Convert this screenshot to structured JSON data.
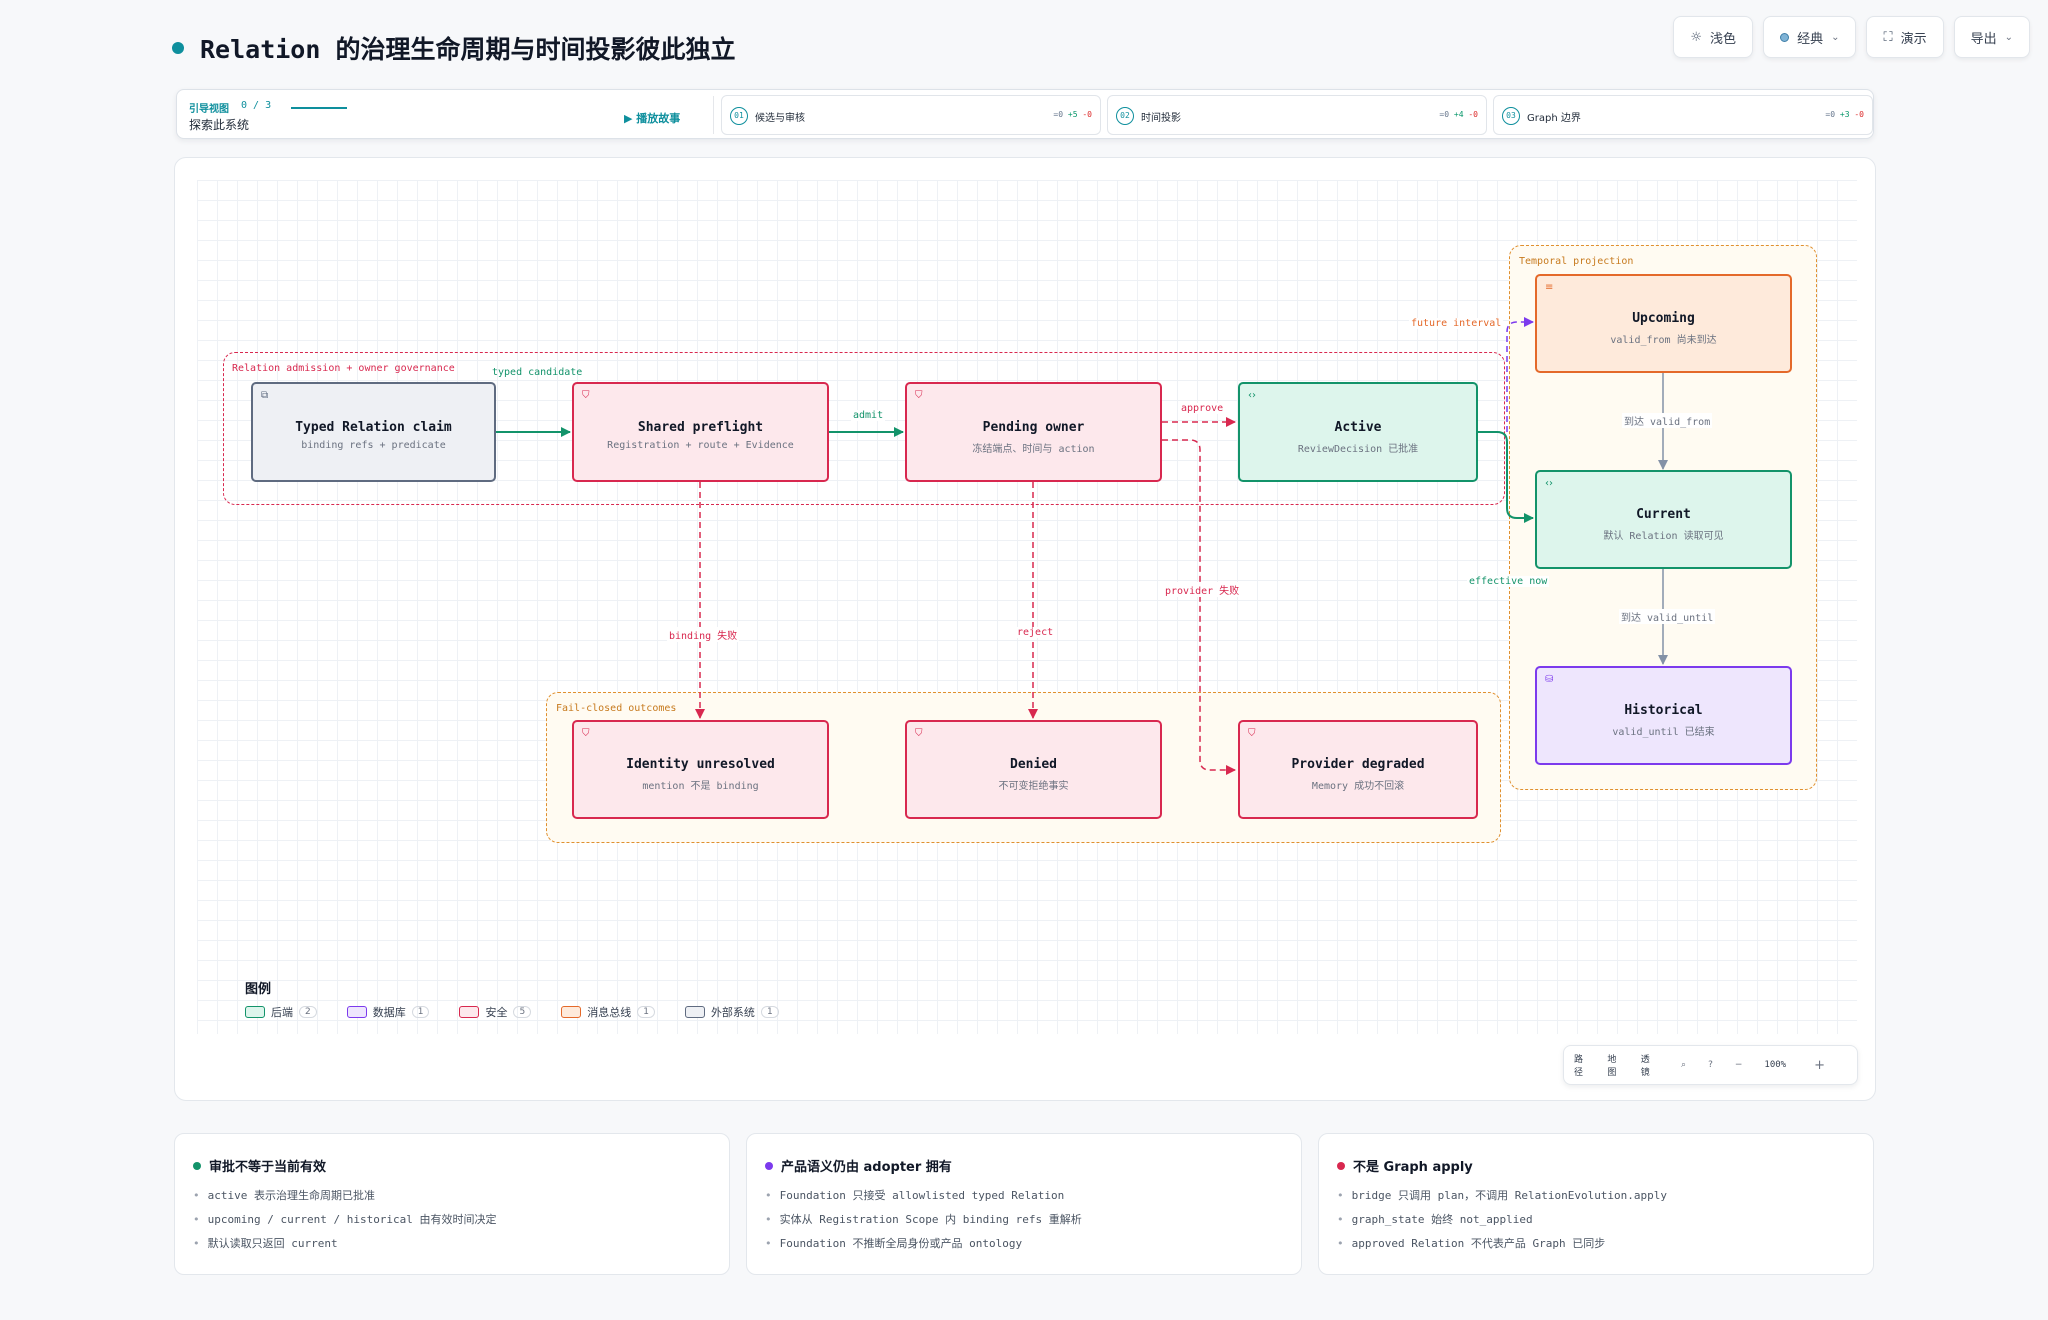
{
  "header": {
    "title": "Relation 的治理生命周期与时间投影彼此独立"
  },
  "toolbar": {
    "theme_label": "浅色",
    "palette_label": "经典",
    "present_label": "演示",
    "export_label": "导出"
  },
  "guide": {
    "label": "引导视图",
    "count": "0 / 3",
    "explore": "探索此系统",
    "play": "播放故事",
    "steps": [
      {
        "num": "01",
        "label": "候选与审核",
        "d0": "=0",
        "dp": "+5",
        "dm": "-0"
      },
      {
        "num": "02",
        "label": "时间投影",
        "d0": "=0",
        "dp": "+4",
        "dm": "-0"
      },
      {
        "num": "03",
        "label": "Graph 边界",
        "d0": "=0",
        "dp": "+3",
        "dm": "-0"
      }
    ]
  },
  "groups": {
    "admission": "Relation admission + owner governance",
    "failclosed": "Fail-closed outcomes",
    "temporal": "Temporal projection"
  },
  "nodes": {
    "typed": {
      "title": "Typed Relation claim",
      "sub": "binding refs + predicate"
    },
    "preflight": {
      "title": "Shared preflight",
      "sub": "Registration + route + Evidence"
    },
    "pending": {
      "title": "Pending owner",
      "sub": "冻结端点、时间与 action"
    },
    "active": {
      "title": "Active",
      "sub": "ReviewDecision 已批准"
    },
    "upcoming": {
      "title": "Upcoming",
      "sub": "valid_from 尚未到达"
    },
    "current": {
      "title": "Current",
      "sub": "默认 Relation 读取可见"
    },
    "historical": {
      "title": "Historical",
      "sub": "valid_until 已结束"
    },
    "identity": {
      "title": "Identity unresolved",
      "sub": "mention 不是 binding"
    },
    "denied": {
      "title": "Denied",
      "sub": "不可变拒绝事实"
    },
    "degraded": {
      "title": "Provider degraded",
      "sub": "Memory 成功不回滚"
    }
  },
  "edges": {
    "typed_candidate": "typed candidate",
    "admit": "admit",
    "approve": "approve",
    "future_interval": "future interval",
    "effective_now": "effective now",
    "reach_from": "到达 valid_from",
    "reach_until": "到达 valid_until",
    "binding_fail": "binding 失败",
    "reject": "reject",
    "provider_fail": "provider 失败"
  },
  "legend": {
    "title": "图例",
    "items": [
      {
        "label": "后端",
        "count": "2",
        "color": "#13936a",
        "fill": "#ddf5ec"
      },
      {
        "label": "数据库",
        "count": "1",
        "color": "#7c3aed",
        "fill": "#eee6fd"
      },
      {
        "label": "安全",
        "count": "5",
        "color": "#d8284f",
        "fill": "#fde8ec"
      },
      {
        "label": "消息总线",
        "count": "1",
        "color": "#e4692a",
        "fill": "#feeadb"
      },
      {
        "label": "外部系统",
        "count": "1",
        "color": "#5f6b80",
        "fill": "#eef0f4"
      }
    ]
  },
  "zoom": {
    "path": "路径",
    "map": "地图",
    "lens": "透镜",
    "level": "100%"
  },
  "cards": [
    {
      "title": "审批不等于当前有效",
      "color": "#13936a",
      "items": [
        "active 表示治理生命周期已批准",
        "upcoming / current / historical 由有效时间决定",
        "默认读取只返回 current"
      ]
    },
    {
      "title": "产品语义仍由 adopter 拥有",
      "color": "#7c3aed",
      "items": [
        "Foundation 只接受 allowlisted typed Relation",
        "实体从 Registration Scope 内 binding refs 重解析",
        "Foundation 不推断全局身份或产品 ontology"
      ]
    },
    {
      "title": "不是 Graph apply",
      "color": "#d8284f",
      "items": [
        "bridge 只调用 plan，不调用 RelationEvolution.apply",
        "graph_state 始终 not_applied",
        "approved Relation 不代表产品 Graph 已同步"
      ]
    }
  ]
}
